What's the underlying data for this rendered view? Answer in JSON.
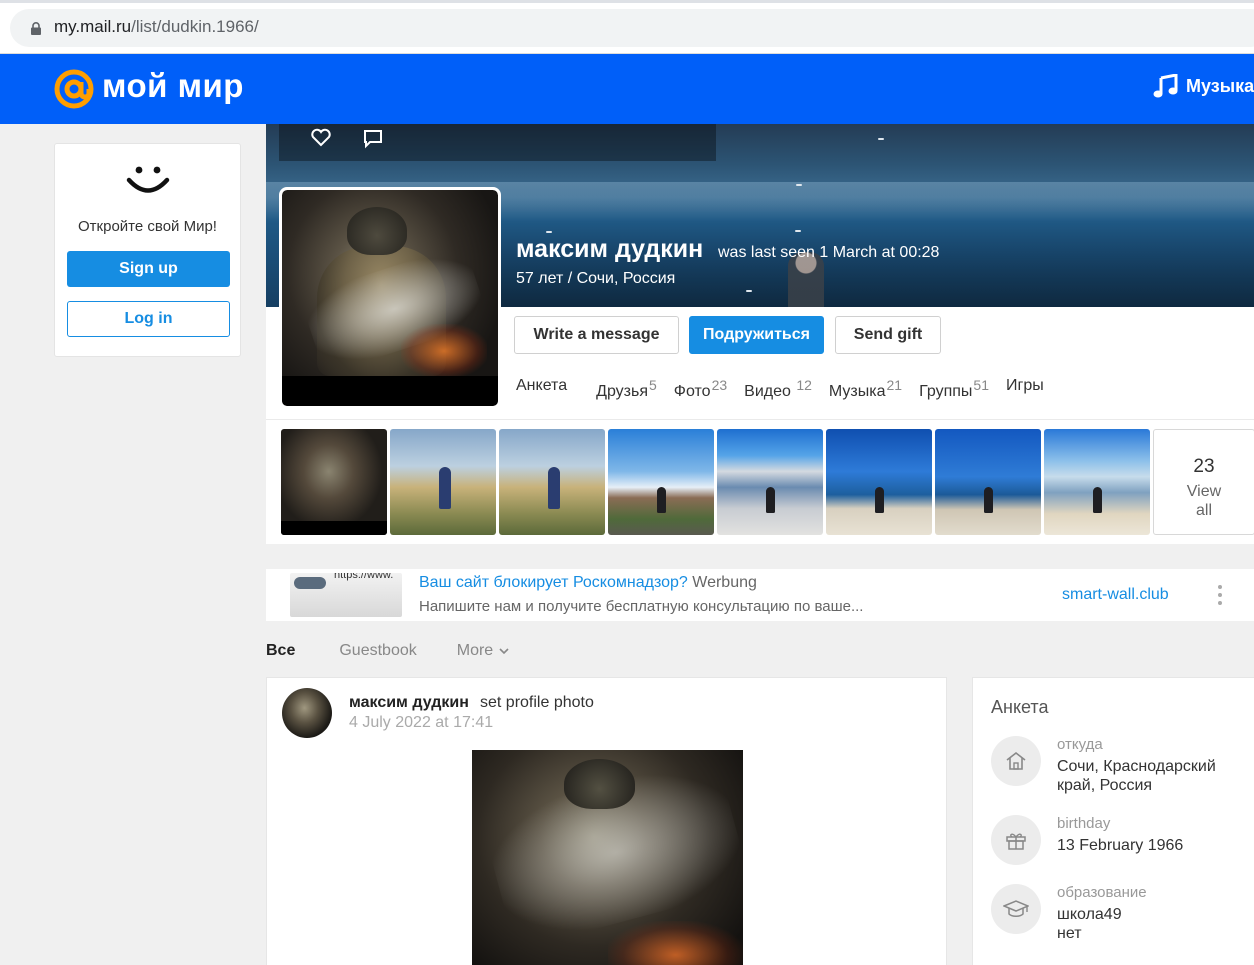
{
  "browser": {
    "url_host": "my.mail.ru",
    "url_path": "/list/dudkin.1966/"
  },
  "header": {
    "logo_text": "мой мир",
    "music_label": "Музыка",
    "brand_color": "#005ff9"
  },
  "promo": {
    "text": "Откройте свой Мир!",
    "signup_label": "Sign up",
    "login_label": "Log in"
  },
  "profile": {
    "name": "максим дудкин",
    "last_seen": "was last seen 1 March at 00:28",
    "subinfo": "57 лет / Сочи, Россия",
    "write_label": "Write a message",
    "friend_label": "Подружиться",
    "gift_label": "Send gift",
    "tabs": [
      {
        "label": "Анкета",
        "count": ""
      },
      {
        "label": "Друзья",
        "count": "5"
      },
      {
        "label": "Фото",
        "count": "23"
      },
      {
        "label": "Видео",
        "count": "12"
      },
      {
        "label": "Музыка",
        "count": "21"
      },
      {
        "label": "Группы",
        "count": "51"
      },
      {
        "label": "Игры",
        "count": ""
      }
    ],
    "photos_count": "23",
    "view_all_line1": "View",
    "view_all_line2": "all"
  },
  "ad": {
    "title": "Ваш сайт блокирует Роскомнадзор?",
    "tag": "Werbung",
    "description": "Напишите нам и получите бесплатную консультацию по ваше...",
    "domain": "smart-wall.club",
    "thumb_text": "https://www."
  },
  "feed": {
    "tabs": [
      "Все",
      "Guestbook",
      "More"
    ]
  },
  "post": {
    "author": "максим дудкин",
    "action": "set profile photo",
    "date": "4 July 2022 at 17:41"
  },
  "about": {
    "title": "Анкета",
    "facts": [
      {
        "label": "откуда",
        "value": "Сочи, Краснодарский край, Россия",
        "icon": "home-icon"
      },
      {
        "label": "birthday",
        "value": "13 February 1966",
        "icon": "gift-icon"
      },
      {
        "label": "образование",
        "value": "школа49\nнет",
        "icon": "graduation-cap-icon"
      }
    ]
  }
}
